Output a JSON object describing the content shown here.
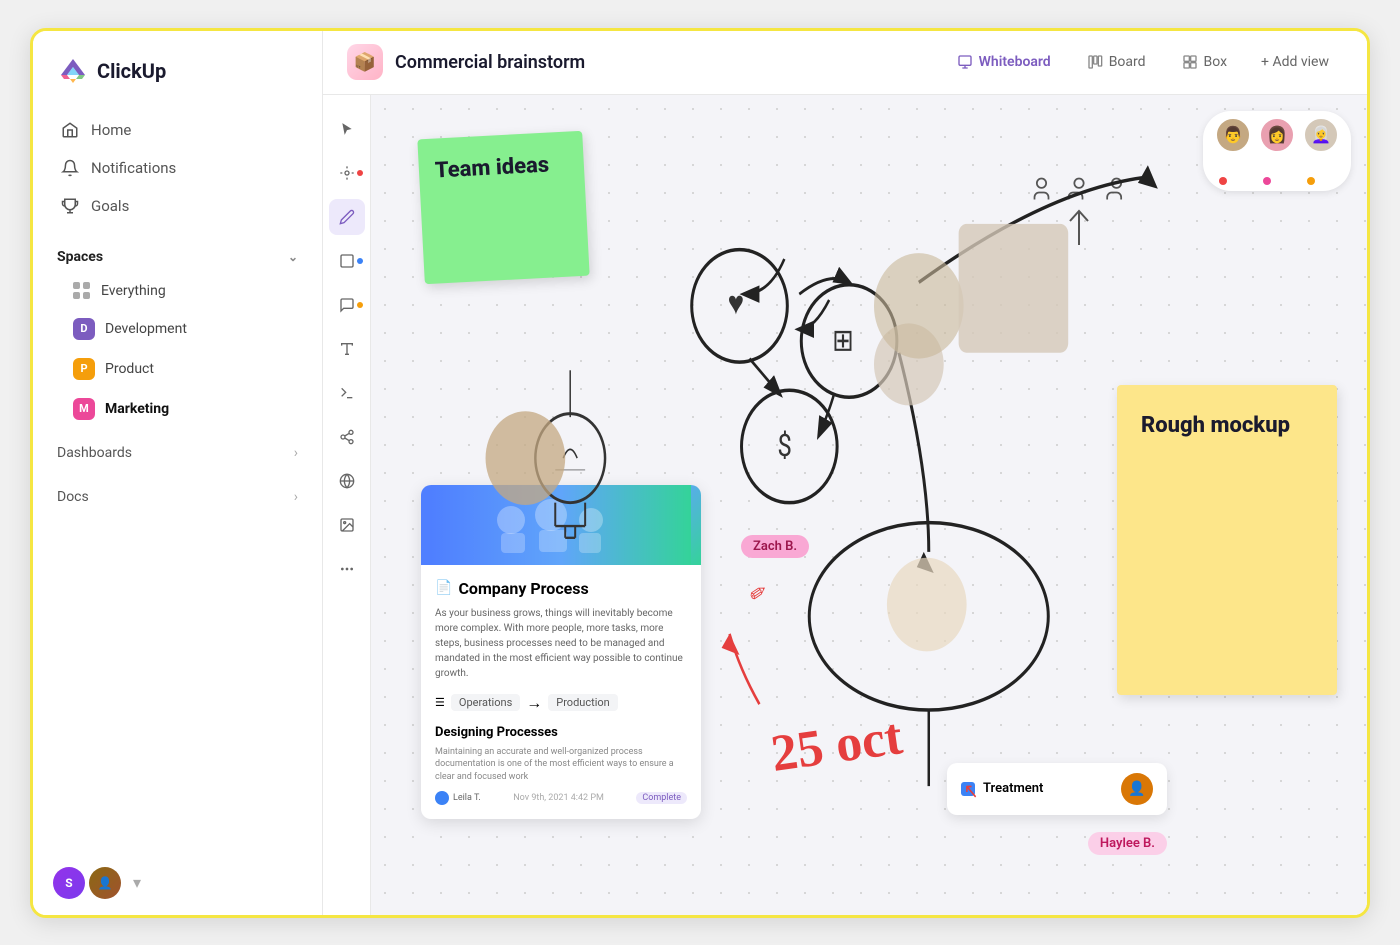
{
  "app": {
    "name": "ClickUp"
  },
  "sidebar": {
    "nav": [
      {
        "id": "home",
        "label": "Home",
        "icon": "home"
      },
      {
        "id": "notifications",
        "label": "Notifications",
        "icon": "bell"
      },
      {
        "id": "goals",
        "label": "Goals",
        "icon": "trophy"
      }
    ],
    "spaces_label": "Spaces",
    "spaces": [
      {
        "id": "everything",
        "label": "Everything",
        "type": "grid"
      },
      {
        "id": "development",
        "label": "Development",
        "color": "#7c5cbf",
        "letter": "D"
      },
      {
        "id": "product",
        "label": "Product",
        "color": "#f59e0b",
        "letter": "P"
      },
      {
        "id": "marketing",
        "label": "Marketing",
        "color": "#ec4899",
        "letter": "M",
        "bold": true
      }
    ],
    "dashboards_label": "Dashboards",
    "docs_label": "Docs"
  },
  "topbar": {
    "project_name": "Commercial brainstorm",
    "tabs": [
      {
        "id": "whiteboard",
        "label": "Whiteboard",
        "active": true
      },
      {
        "id": "board",
        "label": "Board",
        "active": false
      },
      {
        "id": "box",
        "label": "Box",
        "active": false
      }
    ],
    "add_view": "+ Add view"
  },
  "canvas": {
    "sticky_green_label": "Team ideas",
    "sticky_yellow_label": "Rough mockup",
    "task_card": {
      "title": "Company Process",
      "description": "As your business grows, things will inevitably become more complex. With more people, more tasks, more steps, business processes need to be managed and mandated in the most efficient way possible to continue growth.",
      "flow_from": "Operations",
      "flow_to": "Production",
      "subtitle": "Designing Processes",
      "sub_description": "Maintaining an accurate and well-organized process documentation is one of the most efficient ways to ensure a clear and focused work",
      "meta_name": "Leila T.",
      "meta_date": "Nov 9th, 2021 4:42 PM",
      "meta_badge": "Complete"
    },
    "treatment_card": {
      "label": "Treatment",
      "cursor_label": "↖"
    },
    "user_tags": [
      {
        "id": "zach",
        "label": "Zach B."
      },
      {
        "id": "haylee",
        "label": "Haylee B."
      }
    ],
    "date_annotation": "25 oct",
    "collaborators": [
      {
        "id": "collab1",
        "color": "#c4a882"
      },
      {
        "id": "collab2",
        "color": "#d4788a"
      },
      {
        "id": "collab3",
        "color": "#c4b8a0"
      }
    ]
  },
  "toolbar": {
    "tools": [
      {
        "id": "cursor",
        "icon": "▶",
        "active": false
      },
      {
        "id": "shapes",
        "icon": "✦",
        "active": false,
        "dot": "red"
      },
      {
        "id": "pencil",
        "icon": "✏",
        "active": true
      },
      {
        "id": "rectangle",
        "icon": "▢",
        "active": false,
        "dot": "blue"
      },
      {
        "id": "note",
        "icon": "▭",
        "active": false,
        "dot": "orange"
      },
      {
        "id": "text",
        "icon": "T",
        "active": false
      },
      {
        "id": "connector",
        "icon": "⚡",
        "active": false
      },
      {
        "id": "network",
        "icon": "⋯",
        "active": false
      },
      {
        "id": "globe",
        "icon": "🌐",
        "active": false
      },
      {
        "id": "image",
        "icon": "🖼",
        "active": false
      },
      {
        "id": "more",
        "icon": "•••",
        "active": false
      }
    ]
  }
}
